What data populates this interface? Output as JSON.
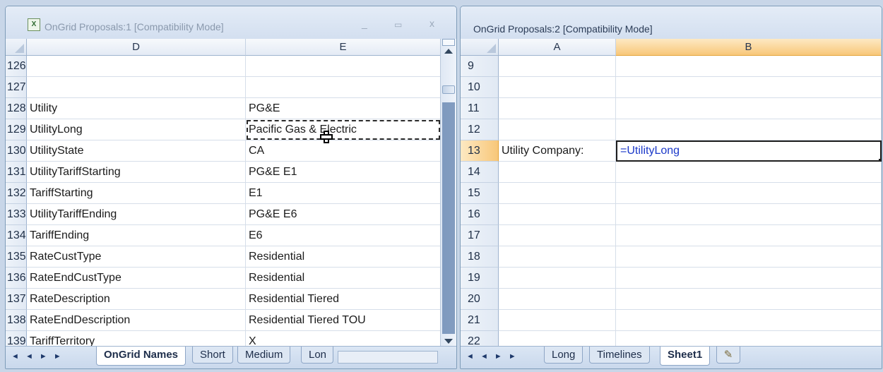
{
  "left_window": {
    "title": "OnGrid Proposals:1  [Compatibility Mode]",
    "app_icon": "excel-icon",
    "controls": [
      "_",
      "▭",
      "x"
    ],
    "columns": [
      "D",
      "E"
    ],
    "rows": [
      {
        "num": "126",
        "d": "",
        "e": ""
      },
      {
        "num": "127",
        "d": "",
        "e": ""
      },
      {
        "num": "128",
        "d": "Utility",
        "e": "PG&E"
      },
      {
        "num": "129",
        "d": "UtilityLong",
        "e": "Pacific Gas & Electric"
      },
      {
        "num": "130",
        "d": "UtilityState",
        "e": "CA"
      },
      {
        "num": "131",
        "d": "UtilityTariffStarting",
        "e": "PG&E E1"
      },
      {
        "num": "132",
        "d": "TariffStarting",
        "e": "E1"
      },
      {
        "num": "133",
        "d": "UtilityTariffEnding",
        "e": "PG&E E6"
      },
      {
        "num": "134",
        "d": "TariffEnding",
        "e": "E6"
      },
      {
        "num": "135",
        "d": "RateCustType",
        "e": "Residential"
      },
      {
        "num": "136",
        "d": "RateEndCustType",
        "e": "Residential"
      },
      {
        "num": "137",
        "d": "RateDescription",
        "e": "Residential Tiered"
      },
      {
        "num": "138",
        "d": "RateEndDescription",
        "e": "Residential Tiered TOU"
      },
      {
        "num": "139",
        "d": "TariffTerritory",
        "e": "X"
      }
    ],
    "tabs": [
      "OnGrid Names",
      "Short",
      "Medium",
      "Lon"
    ],
    "nav": "◄ ◄ ► ►"
  },
  "right_window": {
    "title": "OnGrid Proposals:2  [Compatibility Mode]",
    "columns": [
      "A",
      "B"
    ],
    "rows": [
      {
        "num": "9",
        "a": "",
        "b": ""
      },
      {
        "num": "10",
        "a": "",
        "b": ""
      },
      {
        "num": "11",
        "a": "",
        "b": ""
      },
      {
        "num": "12",
        "a": "",
        "b": ""
      },
      {
        "num": "13",
        "a": "Utility Company:",
        "b": "=UtilityLong"
      },
      {
        "num": "14",
        "a": "",
        "b": ""
      },
      {
        "num": "15",
        "a": "",
        "b": ""
      },
      {
        "num": "16",
        "a": "",
        "b": ""
      },
      {
        "num": "17",
        "a": "",
        "b": ""
      },
      {
        "num": "18",
        "a": "",
        "b": ""
      },
      {
        "num": "19",
        "a": "",
        "b": ""
      },
      {
        "num": "20",
        "a": "",
        "b": ""
      },
      {
        "num": "21",
        "a": "",
        "b": ""
      },
      {
        "num": "22",
        "a": "",
        "b": ""
      }
    ],
    "tabs": [
      "Long",
      "Timelines",
      "Sheet1"
    ],
    "nav": "◄ ◄ ► ►"
  },
  "colors": {
    "selected_header": "#f8c779",
    "formula_text": "#1b39c9",
    "tab_bar": "#c9d8ec"
  }
}
